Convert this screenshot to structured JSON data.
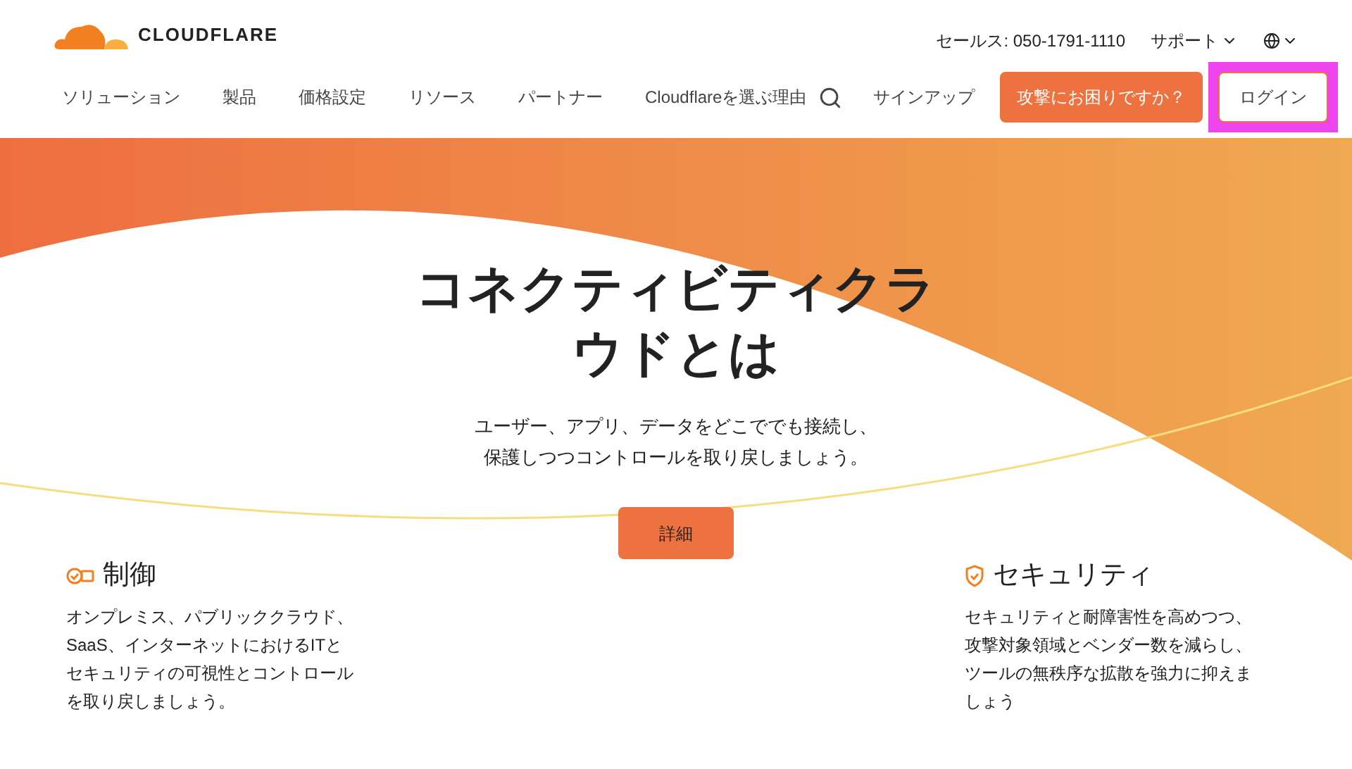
{
  "header": {
    "logo": "CLOUDFLARE",
    "sales": "セールス: 050-1791-1110",
    "support": "サポート",
    "nav": [
      "ソリューション",
      "製品",
      "価格設定",
      "リソース",
      "パートナー",
      "Cloudflareを選ぶ理由"
    ],
    "signup": "サインアップ",
    "attack_button": "攻撃にお困りですか？",
    "login": {
      "label": "ログイン",
      "highlighted": true
    }
  },
  "hero": {
    "title": "コネクティビティクラウドとは",
    "subtitle": "ユーザー、アプリ、データをどこででも接続し、保護しつつコントロールを取り戻しましょう。",
    "button": "詳細"
  },
  "features": [
    {
      "kind": "control",
      "title": "制御",
      "text": "オンプレミス、パブリッククラウド、SaaS、インターネットにおけるITとセキュリティの可視性とコントロールを取り戻しましょう。"
    },
    {
      "kind": "security",
      "title": "セキュリティ",
      "text": "セキュリティと耐障害性を高めつつ、攻撃対象領域とベンダー数を減らし、ツールの無秩序な拡散を強力に抑えましょう"
    }
  ]
}
